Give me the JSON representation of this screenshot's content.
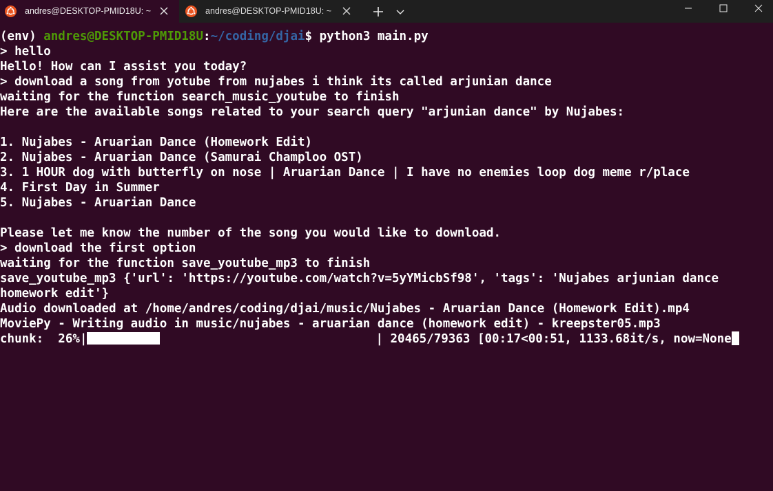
{
  "window": {
    "tabs": [
      {
        "title": "andres@DESKTOP-PMID18U: ~",
        "icon": "ubuntu-icon",
        "active": true
      },
      {
        "title": "andres@DESKTOP-PMID18U: ~",
        "icon": "ubuntu-icon",
        "active": false
      }
    ],
    "new_tab": "+",
    "controls": [
      "minimize",
      "maximize",
      "close"
    ]
  },
  "colors": {
    "background": "#300a24",
    "titlebar": "#1f1f1f",
    "prompt_user": "#4e9a06",
    "prompt_path": "#3465a4",
    "text": "#ffffff",
    "ubuntu_orange": "#e95420"
  },
  "terminal": {
    "prompt": {
      "env": "(env) ",
      "user_host": "andres@DESKTOP-PMID18U",
      "colon": ":",
      "path": "~/coding/djai",
      "symbol": "$",
      "command": " python3 main.py"
    },
    "lines": [
      "> hello",
      "Hello! How can I assist you today?",
      "> download a song from yotube from nujabes i think its called arjunian dance",
      "waiting for the function search_music_youtube to finish",
      "Here are the available songs related to your search query \"arjunian dance\" by Nujabes:",
      "",
      "1. Nujabes - Aruarian Dance (Homework Edit)",
      "2. Nujabes - Aruarian Dance (Samurai Champloo OST)",
      "3. 1 HOUR dog with butterfly on nose | Aruarian Dance | I have no enemies loop dog meme r/place",
      "4. First Day in Summer",
      "5. Nujabes - Aruarian Dance",
      "",
      "Please let me know the number of the song you would like to download.",
      "> download the first option",
      "waiting for the function save_youtube_mp3 to finish",
      "save_youtube_mp3 {'url': 'https://youtube.com/watch?v=5yYMicbSf98', 'tags': 'Nujabes arjunian dance",
      "homework edit'}",
      "Audio downloaded at /home/andres/coding/djai/music/Nujabes - Aruarian Dance (Homework Edit).mp4",
      "MoviePy - Writing audio in music/nujabes - aruarian dance (homework edit) - kreepster05.mp3"
    ],
    "progress": {
      "prefix": "chunk:  26%|",
      "percent": 26,
      "suffix": "| 20465/79363 [00:17<00:51, 1133.68it/s, now=None"
    }
  }
}
